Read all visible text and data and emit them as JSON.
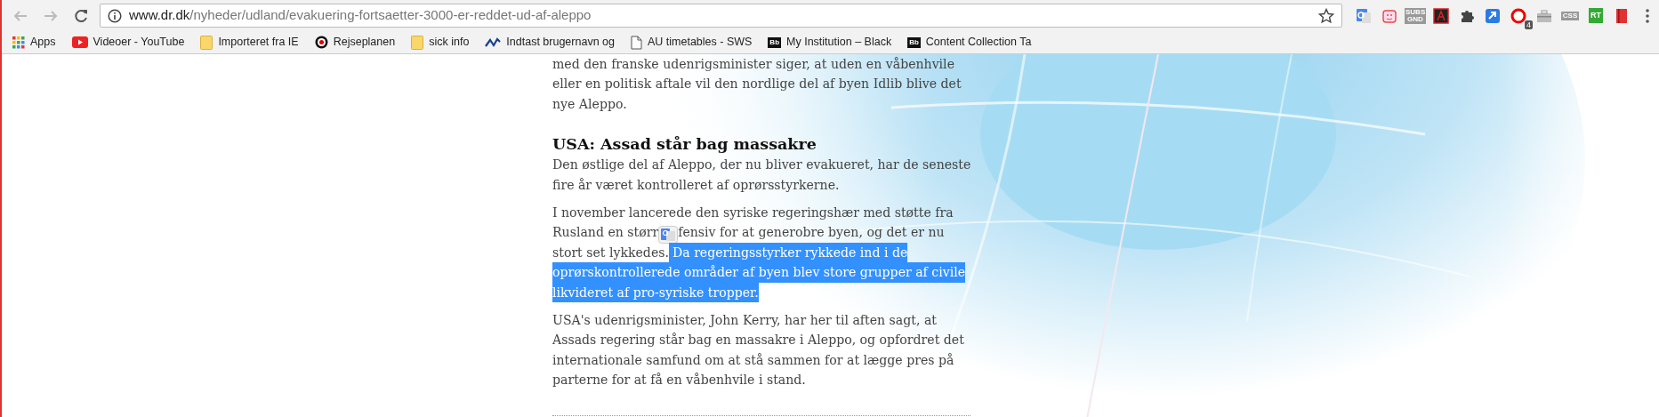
{
  "address_bar": {
    "host": "www.dr.dk",
    "path": "/nyheder/udland/evakuering-fortsaetter-3000-er-reddet-ud-af-aleppo"
  },
  "extensions": [
    {
      "kind": "translate"
    },
    {
      "kind": "face"
    },
    {
      "kind": "tag",
      "label": "SUBS GND"
    },
    {
      "kind": "pdf"
    },
    {
      "kind": "puzzle"
    },
    {
      "kind": "arrow"
    },
    {
      "kind": "ring",
      "badge": "4"
    },
    {
      "kind": "toolbox"
    },
    {
      "kind": "tag",
      "label": "CSS"
    },
    {
      "kind": "logo",
      "label": "RT"
    },
    {
      "kind": "book"
    }
  ],
  "bookmarks": [
    {
      "kind": "apps",
      "label": "Apps"
    },
    {
      "kind": "youtube",
      "label": "Videoer - YouTube"
    },
    {
      "kind": "folder",
      "label": "Importeret fra IE"
    },
    {
      "kind": "target",
      "label": "Rejseplanen"
    },
    {
      "kind": "folder",
      "label": "sick info"
    },
    {
      "kind": "wave",
      "label": "Indtast brugernavn og"
    },
    {
      "kind": "page",
      "label": "AU timetables - SWS"
    },
    {
      "kind": "bb",
      "icon_text": "Bb",
      "label": "My Institution – Black"
    },
    {
      "kind": "bb",
      "icon_text": "Bb",
      "label": "Content Collection Ta"
    }
  ],
  "article": [
    {
      "kind": "paragraph",
      "lines": [
        "med den franske udenrigsminister siger, at uden en våbenhvile",
        "eller en politisk aftale vil den nordlige del af byen Idlib blive det",
        "nye Aleppo."
      ]
    },
    {
      "kind": "heading",
      "text": "USA: Assad står bag massakre"
    },
    {
      "kind": "paragraph",
      "lines": [
        "Den østlige del af Aleppo, der nu bliver evakueret, har de seneste",
        "fire år været kontrolleret af oprørsstyrkerne."
      ]
    },
    {
      "kind": "mixed",
      "lines": [
        [
          {
            "kind": "text",
            "text": "I november lancerede den syriske regeringshær med støtte fra",
            "highlighted": false
          }
        ],
        [
          {
            "kind": "text",
            "text": "Rusland en størr",
            "highlighted": false
          },
          {
            "kind": "icon"
          },
          {
            "kind": "text",
            "text": "fensiv for at generobre byen, og det er nu",
            "highlighted": false
          }
        ],
        [
          {
            "kind": "text",
            "text": "stort set lykkedes.",
            "highlighted": false
          },
          {
            "kind": "text",
            "text": "Da regeringsstyrker rykkede ind i de",
            "highlighted": true
          }
        ],
        [
          {
            "kind": "text",
            "text": "oprørskontrollerede områder af byen blev store grupper af civile",
            "highlighted": true
          }
        ],
        [
          {
            "kind": "text",
            "text": "likvideret af pro-syriske tropper.",
            "highlighted": true
          }
        ]
      ]
    },
    {
      "kind": "paragraph",
      "lines": [
        "USA's udenrigsminister, John Kerry, har her til aften sagt, at",
        "Assads regering står bag en massakre i Aleppo, og opfordret det",
        "internationale samfund om at stå sammen for at lægge pres på",
        "parterne for at få en våbenhvile i stand."
      ]
    }
  ]
}
